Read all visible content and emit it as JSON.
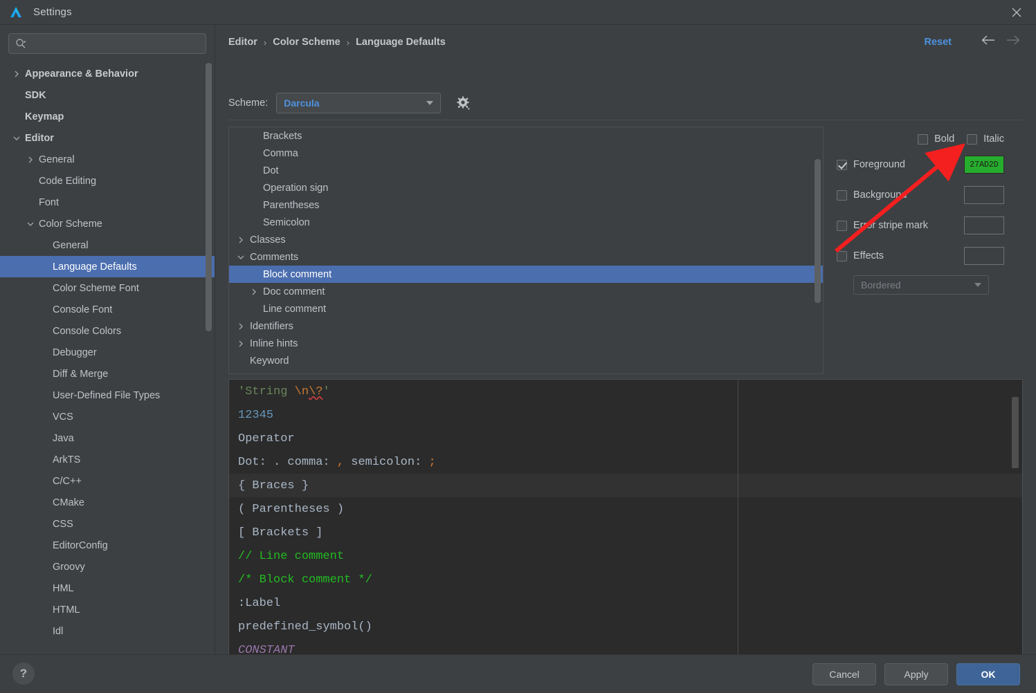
{
  "window": {
    "title": "Settings",
    "logo_icon": "deveco-logo-icon",
    "close_icon": "close-icon"
  },
  "sidebar": {
    "search": {
      "placeholder": "",
      "value": "",
      "icon": "search-icon"
    },
    "items": [
      {
        "label": "Appearance & Behavior",
        "indent": 0,
        "arrow": "right",
        "bold": true,
        "selected": false
      },
      {
        "label": "SDK",
        "indent": 0,
        "arrow": "none",
        "bold": true,
        "selected": false
      },
      {
        "label": "Keymap",
        "indent": 0,
        "arrow": "none",
        "bold": true,
        "selected": false
      },
      {
        "label": "Editor",
        "indent": 0,
        "arrow": "down",
        "bold": true,
        "selected": false
      },
      {
        "label": "General",
        "indent": 1,
        "arrow": "right",
        "bold": false,
        "selected": false
      },
      {
        "label": "Code Editing",
        "indent": 1,
        "arrow": "none",
        "bold": false,
        "selected": false
      },
      {
        "label": "Font",
        "indent": 1,
        "arrow": "none",
        "bold": false,
        "selected": false
      },
      {
        "label": "Color Scheme",
        "indent": 1,
        "arrow": "down",
        "bold": false,
        "selected": false
      },
      {
        "label": "General",
        "indent": 2,
        "arrow": "none",
        "bold": false,
        "selected": false
      },
      {
        "label": "Language Defaults",
        "indent": 2,
        "arrow": "none",
        "bold": false,
        "selected": true
      },
      {
        "label": "Color Scheme Font",
        "indent": 2,
        "arrow": "none",
        "bold": false,
        "selected": false
      },
      {
        "label": "Console Font",
        "indent": 2,
        "arrow": "none",
        "bold": false,
        "selected": false
      },
      {
        "label": "Console Colors",
        "indent": 2,
        "arrow": "none",
        "bold": false,
        "selected": false
      },
      {
        "label": "Debugger",
        "indent": 2,
        "arrow": "none",
        "bold": false,
        "selected": false
      },
      {
        "label": "Diff & Merge",
        "indent": 2,
        "arrow": "none",
        "bold": false,
        "selected": false
      },
      {
        "label": "User-Defined File Types",
        "indent": 2,
        "arrow": "none",
        "bold": false,
        "selected": false
      },
      {
        "label": "VCS",
        "indent": 2,
        "arrow": "none",
        "bold": false,
        "selected": false
      },
      {
        "label": "Java",
        "indent": 2,
        "arrow": "none",
        "bold": false,
        "selected": false
      },
      {
        "label": "ArkTS",
        "indent": 2,
        "arrow": "none",
        "bold": false,
        "selected": false
      },
      {
        "label": "C/C++",
        "indent": 2,
        "arrow": "none",
        "bold": false,
        "selected": false
      },
      {
        "label": "CMake",
        "indent": 2,
        "arrow": "none",
        "bold": false,
        "selected": false
      },
      {
        "label": "CSS",
        "indent": 2,
        "arrow": "none",
        "bold": false,
        "selected": false
      },
      {
        "label": "EditorConfig",
        "indent": 2,
        "arrow": "none",
        "bold": false,
        "selected": false
      },
      {
        "label": "Groovy",
        "indent": 2,
        "arrow": "none",
        "bold": false,
        "selected": false
      },
      {
        "label": "HML",
        "indent": 2,
        "arrow": "none",
        "bold": false,
        "selected": false
      },
      {
        "label": "HTML",
        "indent": 2,
        "arrow": "none",
        "bold": false,
        "selected": false
      },
      {
        "label": "Idl",
        "indent": 2,
        "arrow": "none",
        "bold": false,
        "selected": false
      }
    ]
  },
  "content": {
    "breadcrumb": [
      "Editor",
      "Color Scheme",
      "Language Defaults"
    ],
    "breadcrumb_separator": "›",
    "reset_label": "Reset",
    "back_icon": "arrow-left-icon",
    "forward_icon": "arrow-right-icon",
    "scheme": {
      "label": "Scheme:",
      "value": "Darcula",
      "gear_icon": "gear-icon"
    },
    "categories": [
      {
        "label": "Brackets",
        "indent": 1,
        "arrow": "none",
        "selected": false
      },
      {
        "label": "Comma",
        "indent": 1,
        "arrow": "none",
        "selected": false
      },
      {
        "label": "Dot",
        "indent": 1,
        "arrow": "none",
        "selected": false
      },
      {
        "label": "Operation sign",
        "indent": 1,
        "arrow": "none",
        "selected": false
      },
      {
        "label": "Parentheses",
        "indent": 1,
        "arrow": "none",
        "selected": false
      },
      {
        "label": "Semicolon",
        "indent": 1,
        "arrow": "none",
        "selected": false
      },
      {
        "label": "Classes",
        "indent": 0,
        "arrow": "right",
        "selected": false
      },
      {
        "label": "Comments",
        "indent": 0,
        "arrow": "down",
        "selected": false
      },
      {
        "label": "Block comment",
        "indent": 1,
        "arrow": "none",
        "selected": true
      },
      {
        "label": "Doc comment",
        "indent": 1,
        "arrow": "right",
        "selected": false
      },
      {
        "label": "Line comment",
        "indent": 1,
        "arrow": "none",
        "selected": false
      },
      {
        "label": "Identifiers",
        "indent": 0,
        "arrow": "right",
        "selected": false
      },
      {
        "label": "Inline hints",
        "indent": 0,
        "arrow": "right",
        "selected": false
      },
      {
        "label": "Keyword",
        "indent": 0,
        "arrow": "none",
        "selected": false
      }
    ],
    "attributes": {
      "bold": {
        "label": "Bold",
        "checked": false
      },
      "italic": {
        "label": "Italic",
        "checked": false
      },
      "rows": [
        {
          "label": "Foreground",
          "checked": true,
          "swatch_value": "27AD2D",
          "swatch_color": "#27AD2D"
        },
        {
          "label": "Background",
          "checked": false,
          "swatch_value": "",
          "swatch_color": ""
        },
        {
          "label": "Error stripe mark",
          "checked": false,
          "swatch_value": "",
          "swatch_color": ""
        },
        {
          "label": "Effects",
          "checked": false,
          "swatch_value": "",
          "swatch_color": ""
        }
      ],
      "effect_type": "Bordered"
    },
    "preview": {
      "lines": [
        {
          "id": "l1",
          "highlight": false
        },
        {
          "id": "l2",
          "highlight": false
        },
        {
          "id": "l3",
          "highlight": false
        },
        {
          "id": "l4",
          "highlight": false
        },
        {
          "id": "l5",
          "highlight": true
        },
        {
          "id": "l6",
          "highlight": false
        },
        {
          "id": "l7",
          "highlight": false
        },
        {
          "id": "l8",
          "highlight": false
        },
        {
          "id": "l9",
          "highlight": false
        },
        {
          "id": "l10",
          "highlight": false
        },
        {
          "id": "l11",
          "highlight": false
        },
        {
          "id": "l12",
          "highlight": false
        }
      ],
      "text": {
        "string_literal": "'String ",
        "escape_good": "\\n",
        "escape_bad": "\\?",
        "string_close": "'",
        "number": "12345",
        "operator": "Operator",
        "dot_label": "Dot: ",
        "dot_char": ".",
        "comma_label": " comma: ",
        "comma_char": ",",
        "semicolon_label": " semicolon: ",
        "semicolon_char": ";",
        "braces": "{ Braces }",
        "parentheses": "( Parentheses )",
        "brackets": "[ Brackets ]",
        "line_comment": "// Line comment",
        "block_comment": "/* Block comment */",
        "label": ":Label",
        "predefined_symbol": "predefined_symbol()",
        "constant": "CONSTANT"
      }
    }
  },
  "footer": {
    "help_label": "?",
    "cancel_label": "Cancel",
    "apply_label": "Apply",
    "ok_label": "OK"
  },
  "annotation": {
    "arrow_color": "#f41f1f",
    "description": "red-arrow pointing at foreground color swatch"
  }
}
